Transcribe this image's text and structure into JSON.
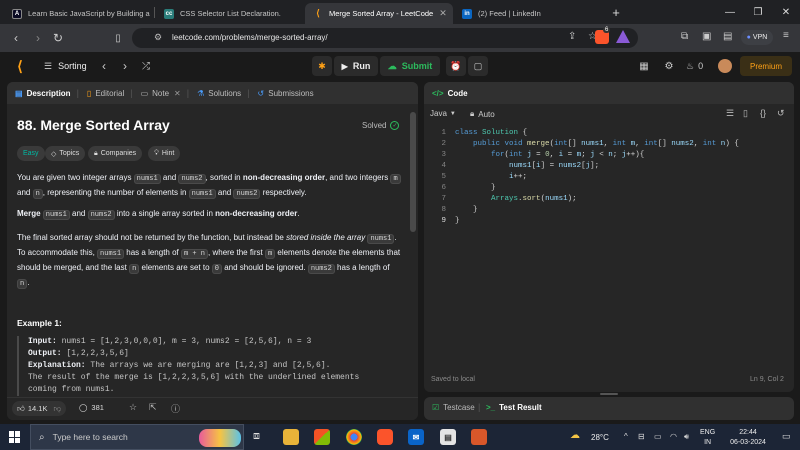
{
  "browser": {
    "tabs": [
      {
        "label": "Learn Basic JavaScript by Building a",
        "favicon": "A"
      },
      {
        "label": "CSS Selector List Declaration.",
        "favicon": "cc"
      },
      {
        "label": "Merge Sorted Array - LeetCode",
        "favicon": "lc"
      },
      {
        "label": "(2) Feed | LinkedIn",
        "favicon": "in"
      }
    ],
    "new_tab": "+",
    "url": "leetcode.com/problems/merge-sorted-array/",
    "vpn_label": "VPN",
    "brave_badge": "6"
  },
  "lc_header": {
    "list_label": "Sorting",
    "run_label": "Run",
    "submit_label": "Submit",
    "streak_count": "0",
    "premium_label": "Premium"
  },
  "left_panel": {
    "tabs": {
      "description": "Description",
      "editorial": "Editorial",
      "note": "Note",
      "solutions": "Solutions",
      "submissions": "Submissions"
    },
    "title": "88. Merge Sorted Array",
    "status": "Solved",
    "chips": {
      "difficulty": "Easy",
      "topics": "Topics",
      "companies": "Companies",
      "hint": "Hint"
    },
    "p1": {
      "a": "You are given two integer arrays ",
      "c1": "nums1",
      "b": " and ",
      "c2": "nums2",
      "c": ", sorted in ",
      "bold": "non-decreasing order",
      "d": ", and two integers ",
      "c3": "m",
      "e": " and ",
      "c4": "n",
      "f": ", representing the number of elements in ",
      "c5": "nums1",
      "g": " and ",
      "c6": "nums2",
      "h": " respectively."
    },
    "p2": {
      "bold1": "Merge",
      "c1": "nums1",
      "a": " and ",
      "c2": "nums2",
      "b": " into a single array sorted in ",
      "bold2": "non-decreasing order",
      "c": "."
    },
    "p3": {
      "a": "The final sorted array should not be returned by the function, but instead be ",
      "em": "stored inside the array",
      "c1": "nums1",
      "b": ". To accommodate this, ",
      "c2": "nums1",
      "c": " has a length of ",
      "c3": "m + n",
      "d": ", where the first ",
      "c4": "m",
      "e": " elements denote the elements that should be merged, and the last ",
      "c5": "n",
      "f": " elements are set to ",
      "c6": "0",
      "g": " and should be ignored. ",
      "c7": "nums2",
      "h": " has a length of ",
      "c8": "n",
      "i": "."
    },
    "example_heading": "Example 1:",
    "example": {
      "input_label": "Input:",
      "input": "nums1 = [1,2,3,0,0,0], m = 3, nums2 = [2,5,6], n = 3",
      "output_label": "Output:",
      "output": "[1,2,2,3,5,6]",
      "explanation_label": "Explanation:",
      "explanation": "The arrays we are merging are [1,2,3] and [2,5,6].",
      "line4": "The result of the merge is [1,2,2,3,5,6] with the underlined elements",
      "line5": "coming from nums1."
    },
    "footer": {
      "likes": "14.1K",
      "comments": "381"
    }
  },
  "code_panel": {
    "title": "Code",
    "language": "Java",
    "mode": "Auto",
    "saved": "Saved to local",
    "cursor": "Ln 9, Col 2",
    "lines": [
      "class Solution {",
      "    public void merge(int[] nums1, int m, int[] nums2, int n) {",
      "        for(int j = 0, i = m; j < n; j++){",
      "            nums1[i] = nums2[j];",
      "            i++;",
      "        }",
      "        Arrays.sort(nums1);",
      "    }",
      "}"
    ]
  },
  "test_panel": {
    "testcase": "Testcase",
    "test_result": "Test Result"
  },
  "taskbar": {
    "search_placeholder": "Type here to search",
    "temperature": "28°C",
    "lang1": "ENG",
    "lang2": "IN",
    "time": "22:44",
    "date": "06-03-2024"
  }
}
